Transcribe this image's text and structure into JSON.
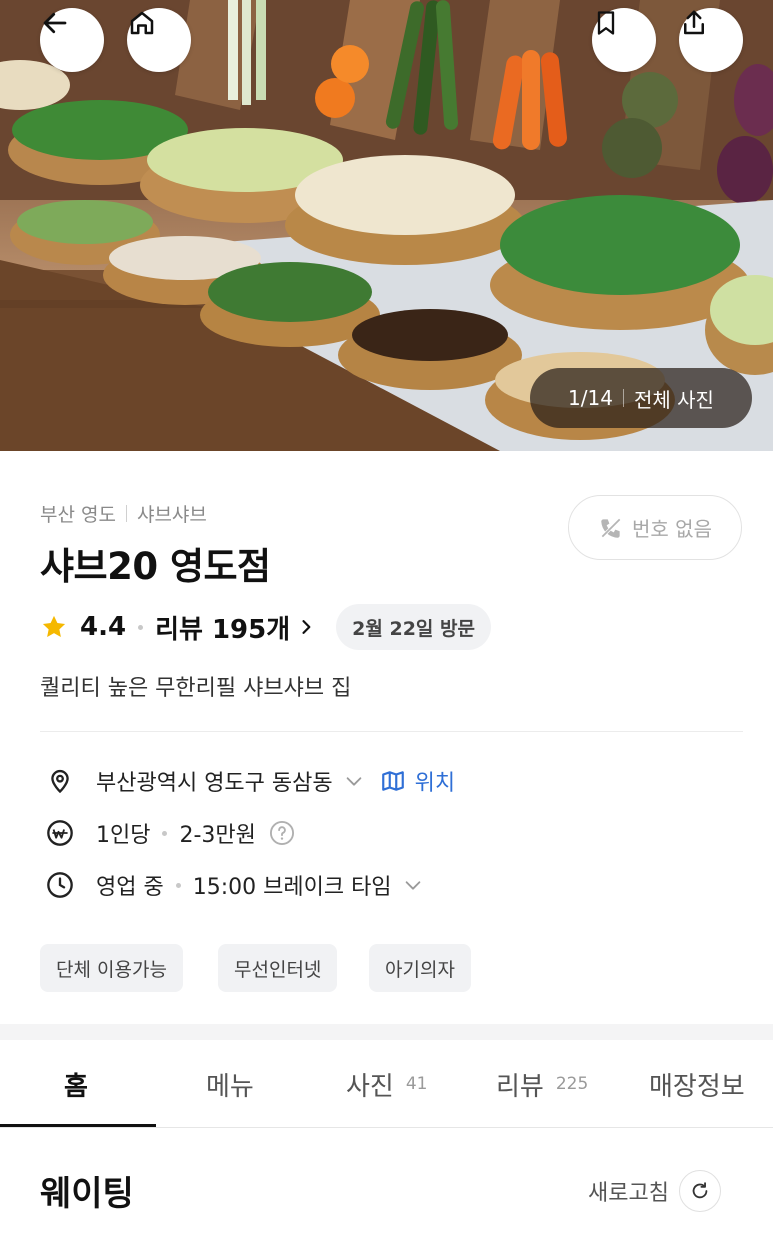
{
  "photos": {
    "current": "1/14",
    "all_label": "전체 사진"
  },
  "store": {
    "region": "부산 영도",
    "category": "샤브샤브",
    "name": "샤브20 영도점",
    "rating": "4.4",
    "reviews": "리뷰 195개",
    "visit": "2월 22일 방문",
    "description": "퀄리티 높은 무한리필 샤브샤브 집",
    "call_label": "번호 없음"
  },
  "info": {
    "address": "부산광역시 영도구 동삼동",
    "location_label": "위치",
    "per_person": "1인당",
    "price": "2-3만원",
    "status": "영업 중",
    "hours": "15:00 브레이크 타임"
  },
  "features": [
    "단체 이용가능",
    "무선인터넷",
    "아기의자"
  ],
  "tabs": [
    {
      "label": "홈",
      "count": ""
    },
    {
      "label": "메뉴",
      "count": ""
    },
    {
      "label": "사진",
      "count": "41"
    },
    {
      "label": "리뷰",
      "count": "225"
    },
    {
      "label": "매장정보",
      "count": ""
    }
  ],
  "waiting": {
    "title": "웨이팅",
    "refresh_label": "새로고침"
  },
  "icons": [
    "back-arrow-icon",
    "home-icon",
    "bookmark-icon",
    "share-icon",
    "no-phone-icon",
    "star-icon",
    "chevron-right-icon",
    "location-pin-icon",
    "map-icon",
    "won-icon",
    "question-icon",
    "clock-icon",
    "chevron-down-icon",
    "refresh-icon"
  ],
  "colors": {
    "star": "#f5b800",
    "link": "#2f6fd6",
    "chip_bg": "#f1f2f4"
  }
}
